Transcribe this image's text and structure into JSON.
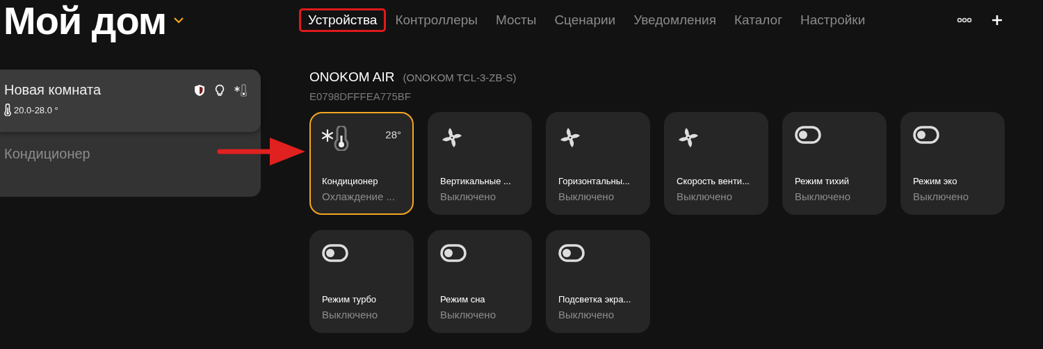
{
  "header": {
    "title": "Мой дом",
    "tabs": [
      {
        "label": "Устройства",
        "selected": true
      },
      {
        "label": "Контроллеры",
        "selected": false
      },
      {
        "label": "Мосты",
        "selected": false
      },
      {
        "label": "Сценарии",
        "selected": false
      },
      {
        "label": "Уведомления",
        "selected": false
      },
      {
        "label": "Каталог",
        "selected": false
      },
      {
        "label": "Настройки",
        "selected": false
      }
    ]
  },
  "sidebar": {
    "room": {
      "name": "Новая комната",
      "range": "20.0-28.0 °"
    },
    "items": [
      {
        "label": "Кондиционер",
        "selected": false
      }
    ]
  },
  "device": {
    "name": "ONOKOM AIR",
    "model": "(ONOKOM TCL-3-ZB-S)",
    "id": "E0798DFFFEA775BF",
    "tiles": [
      {
        "kind": "climate",
        "label": "Кондиционер",
        "status": "Охлаждение ...",
        "value": "28°",
        "selected": true
      },
      {
        "kind": "fan",
        "label": "Вертикальные ...",
        "status": "Выключено",
        "selected": false
      },
      {
        "kind": "fan",
        "label": "Горизонтальны...",
        "status": "Выключено",
        "selected": false
      },
      {
        "kind": "fan",
        "label": "Скорость венти...",
        "status": "Выключено",
        "selected": false
      },
      {
        "kind": "switch",
        "label": "Режим тихий",
        "status": "Выключено",
        "selected": false,
        "on": false
      },
      {
        "kind": "switch",
        "label": "Режим эко",
        "status": "Выключено",
        "selected": false,
        "on": false
      },
      {
        "kind": "switch",
        "label": "Режим турбо",
        "status": "Выключено",
        "selected": false,
        "on": false
      },
      {
        "kind": "switch",
        "label": "Режим сна",
        "status": "Выключено",
        "selected": false,
        "on": false
      },
      {
        "kind": "switch",
        "label": "Подсветка экра...",
        "status": "Выключено",
        "selected": false,
        "on": false
      }
    ]
  }
}
